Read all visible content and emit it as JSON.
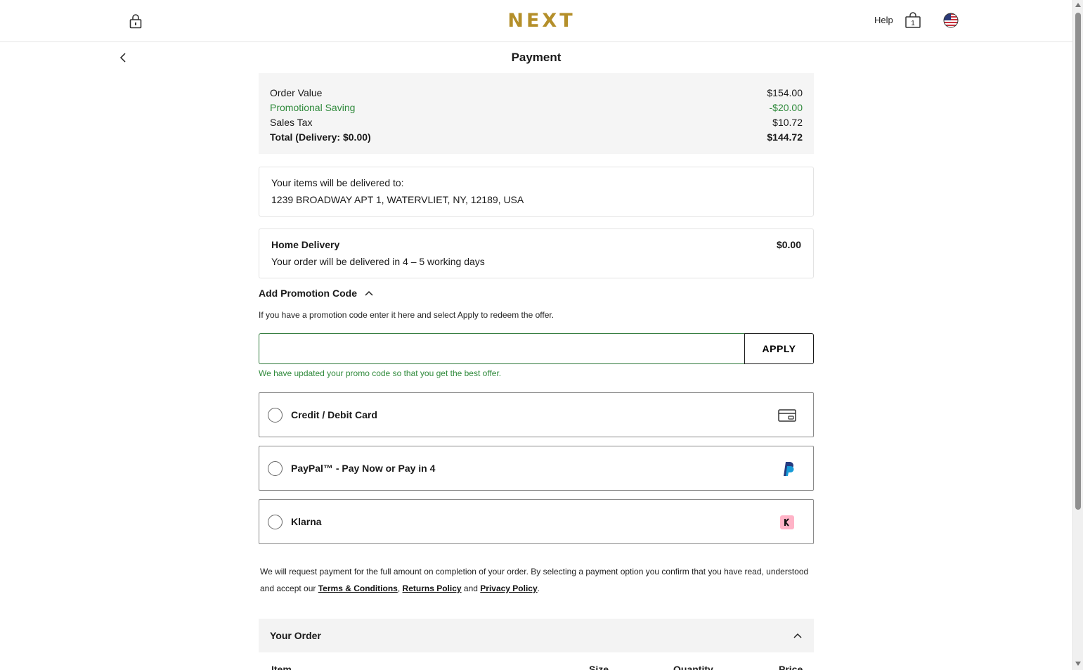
{
  "header": {
    "logo": "NEXT",
    "help": "Help",
    "bag_count": "1"
  },
  "page": {
    "title": "Payment"
  },
  "summary": {
    "rows": [
      {
        "label": "Order Value",
        "value": "$154.00"
      },
      {
        "label": "Promotional Saving",
        "value": "-$20.00"
      },
      {
        "label": "Sales Tax",
        "value": "$10.72"
      },
      {
        "label": "Total (Delivery: $0.00)",
        "value": "$144.72"
      }
    ]
  },
  "delivery_address": {
    "heading": "Your items will be delivered to:",
    "address": "1239 BROADWAY APT 1, WATERVLIET, NY, 12189, USA"
  },
  "delivery_method": {
    "name": "Home Delivery",
    "price": "$0.00",
    "note": "Your order will be delivered in 4 – 5 working days"
  },
  "promo": {
    "heading": "Add Promotion Code",
    "help": "If you have a promotion code enter it here and select Apply to redeem the offer.",
    "input_value": "",
    "apply_label": "APPLY",
    "note": "We have updated your promo code so that you get the best offer."
  },
  "payment_methods": [
    {
      "label": "Credit / Debit Card",
      "icon": "credit-card-icon"
    },
    {
      "label": "PayPal™ - Pay Now or Pay in 4",
      "icon": "paypal-icon"
    },
    {
      "label": "Klarna",
      "icon": "klarna-icon"
    }
  ],
  "legal": {
    "text_before": "We will request payment for the full amount on completion of your order. By selecting a payment option you confirm that you have read, understood and accept our ",
    "terms": "Terms & Conditions",
    "comma": ", ",
    "returns": "Returns Policy",
    "and": " and ",
    "privacy": "Privacy Policy",
    "end": "."
  },
  "your_order": {
    "heading": "Your Order",
    "columns": [
      "Item",
      "Size",
      "Quantity",
      "Price"
    ]
  },
  "colors": {
    "brand_gold": "#b48f2a",
    "success_green": "#2f8a3b",
    "klarna_pink": "#ffb3c7",
    "paypal_blue": "#253b80"
  }
}
